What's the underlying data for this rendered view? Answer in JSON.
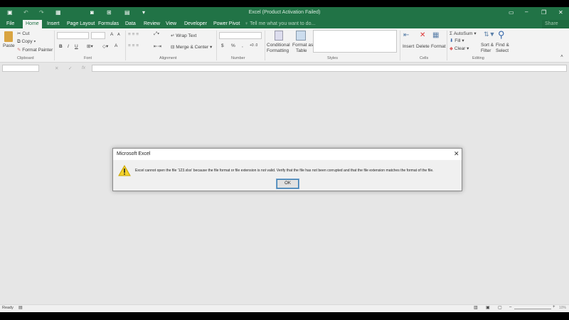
{
  "window": {
    "title": "Excel (Product Activation Failed)",
    "share": "Share"
  },
  "tabs": [
    "File",
    "Home",
    "Insert",
    "Page Layout",
    "Formulas",
    "Data",
    "Review",
    "View",
    "Developer",
    "Power Pivot"
  ],
  "tell_me": "Tell me what you want to do...",
  "ribbon": {
    "clipboard": {
      "paste": "Paste",
      "cut": "Cut",
      "copy": "Copy",
      "format_painter": "Format Painter",
      "group": "Clipboard"
    },
    "font": {
      "bold": "B",
      "italic": "I",
      "underline": "U",
      "grow": "A",
      "shrink": "A",
      "font_color": "A",
      "group": "Font"
    },
    "alignment": {
      "wrap_text": "Wrap Text",
      "merge_center": "Merge & Center",
      "group": "Alignment"
    },
    "number": {
      "currency": "$",
      "percent": "%",
      "comma": ",",
      "group": "Number"
    },
    "styles": {
      "conditional": "Conditional",
      "formatting": "Formatting",
      "format_as": "Format as",
      "table": "Table",
      "group": "Styles"
    },
    "cells": {
      "insert": "Insert",
      "delete": "Delete",
      "format": "Format",
      "group": "Cells"
    },
    "editing": {
      "autosum": "AutoSum",
      "fill": "Fill",
      "clear": "Clear",
      "sort": "Sort &",
      "filter": "Filter",
      "find": "Find &",
      "select": "Select",
      "group": "Editing"
    }
  },
  "formula_bar": {
    "fx": "fx",
    "cancel": "✕",
    "enter": "✓"
  },
  "dialog": {
    "title": "Microsoft Excel",
    "message": "Excel cannot open the file '123.xlsx' because the file format or file extension is not valid. Verify that the file has not been corrupted and that the file extension matches the format of the file.",
    "ok": "OK"
  },
  "status": {
    "ready": "Ready",
    "zoom": "10%"
  }
}
